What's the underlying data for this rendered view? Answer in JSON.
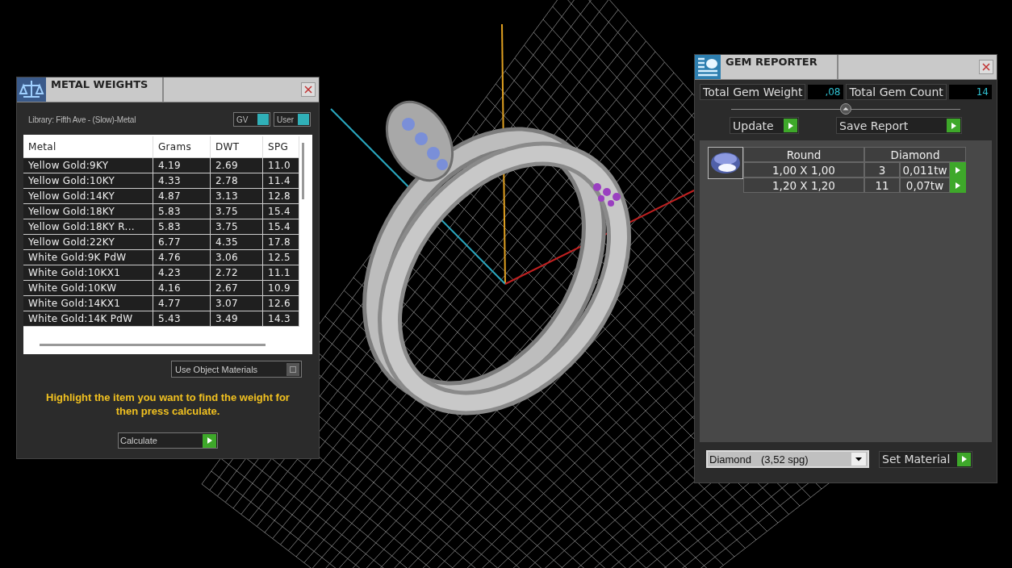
{
  "metal_weights": {
    "title": "METAL WEIGHTS",
    "library": "Library: Fifth Ave - (Slow)-Metal",
    "toggles": [
      {
        "label": "GV",
        "on": true
      },
      {
        "label": "User",
        "on": true
      }
    ],
    "table": {
      "columns": [
        "Metal",
        "Grams",
        "DWT",
        "SPG"
      ],
      "rows": [
        [
          "Yellow Gold:9KY",
          "4.19",
          "2.69",
          "11.0"
        ],
        [
          "Yellow Gold:10KY",
          "4.33",
          "2.78",
          "11.4"
        ],
        [
          "Yellow Gold:14KY",
          "4.87",
          "3.13",
          "12.8"
        ],
        [
          "Yellow Gold:18KY",
          "5.83",
          "3.75",
          "15.4"
        ],
        [
          "Yellow Gold:18KY R...",
          "5.83",
          "3.75",
          "15.4"
        ],
        [
          "Yellow Gold:22KY",
          "6.77",
          "4.35",
          "17.8"
        ],
        [
          "White Gold:9K PdW",
          "4.76",
          "3.06",
          "12.5"
        ],
        [
          "White Gold:10KX1",
          "4.23",
          "2.72",
          "11.1"
        ],
        [
          "White Gold:10KW",
          "4.16",
          "2.67",
          "10.9"
        ],
        [
          "White Gold:14KX1",
          "4.77",
          "3.07",
          "12.6"
        ],
        [
          "White Gold:14K PdW",
          "5.43",
          "3.49",
          "14.3"
        ]
      ]
    },
    "use_object_materials": {
      "label": "Use Object Materials",
      "on": false
    },
    "hint": "Highlight the item you want to find the weight for then press calculate.",
    "calculate_button": "Calculate"
  },
  "gem_reporter": {
    "title": "GEM REPORTER",
    "total_weight": {
      "label": "Total Gem Weight",
      "value": ",08"
    },
    "total_count": {
      "label": "Total Gem Count",
      "value": "14"
    },
    "buttons": [
      "Update",
      "Save Report"
    ],
    "table": {
      "shape": "Round",
      "material": "Diamond",
      "rows": [
        {
          "size": "1,00 X 1,00",
          "count": "3",
          "weight": "0,011tw"
        },
        {
          "size": "1,20 X 1,20",
          "count": "11",
          "weight": "0,07tw"
        }
      ]
    },
    "material_select": {
      "name": "Diamond",
      "density": "(3,52 spg)"
    },
    "set_material_button": "Set Material"
  }
}
